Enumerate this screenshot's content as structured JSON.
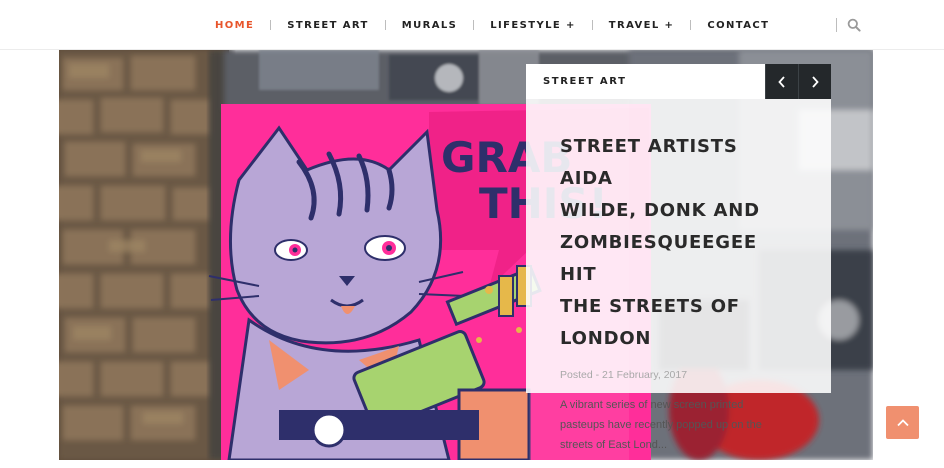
{
  "nav": {
    "items": [
      {
        "label": "HOME",
        "active": true
      },
      {
        "label": "STREET ART",
        "active": false
      },
      {
        "label": "MURALS",
        "active": false
      },
      {
        "label": "LIFESTYLE +",
        "active": false
      },
      {
        "label": "TRAVEL +",
        "active": false
      },
      {
        "label": "CONTACT",
        "active": false
      }
    ],
    "search_icon": "search-icon",
    "active_color": "#e8552b"
  },
  "hero": {
    "poster_text_line1": "GRAB",
    "poster_text_line2": "THIS!",
    "colors": {
      "poster_pink": "#ff2e9a",
      "cat_lavender": "#b8a6d6",
      "gun_green": "#a7d36f",
      "ink_navy": "#2e2f6b",
      "brick": "#6e5c48"
    }
  },
  "card": {
    "category": "STREET ART",
    "prev_icon": "chevron-left-icon",
    "next_icon": "chevron-right-icon",
    "title_lines": [
      "STREET ARTISTS AIDA",
      "WILDE, DONK AND",
      "ZOMBIESQUEEGEE HIT",
      "THE STREETS OF",
      "LONDON"
    ],
    "meta": "Posted - 21 February, 2017",
    "excerpt_lines": [
      "A vibrant series of new screen printed",
      "pasteups have recently popped up on the",
      "streets of East Lond..."
    ]
  },
  "back_to_top": {
    "icon": "chevron-up-icon",
    "color": "#f0906f"
  }
}
